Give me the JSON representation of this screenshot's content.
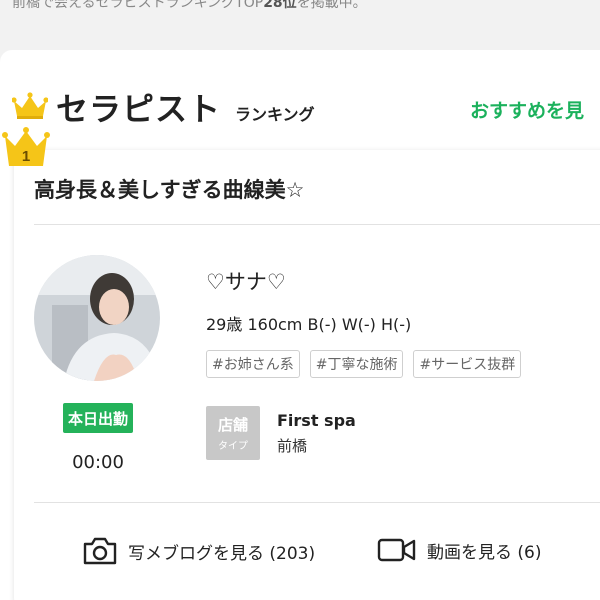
{
  "header_note": {
    "prefix": "前橋で会えるセラピストランキングTOP",
    "count": "28位",
    "suffix": "を掲載中。"
  },
  "section": {
    "title": "セラピスト",
    "subtitle": "ランキング",
    "recommend_link": "おすすめを見"
  },
  "ranking_card": {
    "rank": "1",
    "catchphrase": "高身長＆美しすぎる曲線美☆",
    "therapist": {
      "name": "♡サナ♡",
      "age": "29歳",
      "height": "160cm",
      "bust": "B(-)",
      "waist": "W(-)",
      "hip": "H(-)",
      "tags": [
        "#お姉さん系",
        "#丁寧な施術",
        "#サービス抜群"
      ]
    },
    "status_badge": "本日出勤",
    "start_time": "00:00",
    "shop": {
      "type_label_1": "店舗",
      "type_label_2": "タイプ",
      "name": "First spa",
      "area": "前橋"
    },
    "actions": {
      "blog_label": "写メブログを見る (203)",
      "video_label": "動画を見る (6)"
    }
  },
  "colors": {
    "accent_green": "#24b25a",
    "link_green": "#1bb15c",
    "crown_gold": "#f5c518"
  },
  "icons": [
    "crown-icon",
    "camera-icon",
    "video-icon"
  ]
}
